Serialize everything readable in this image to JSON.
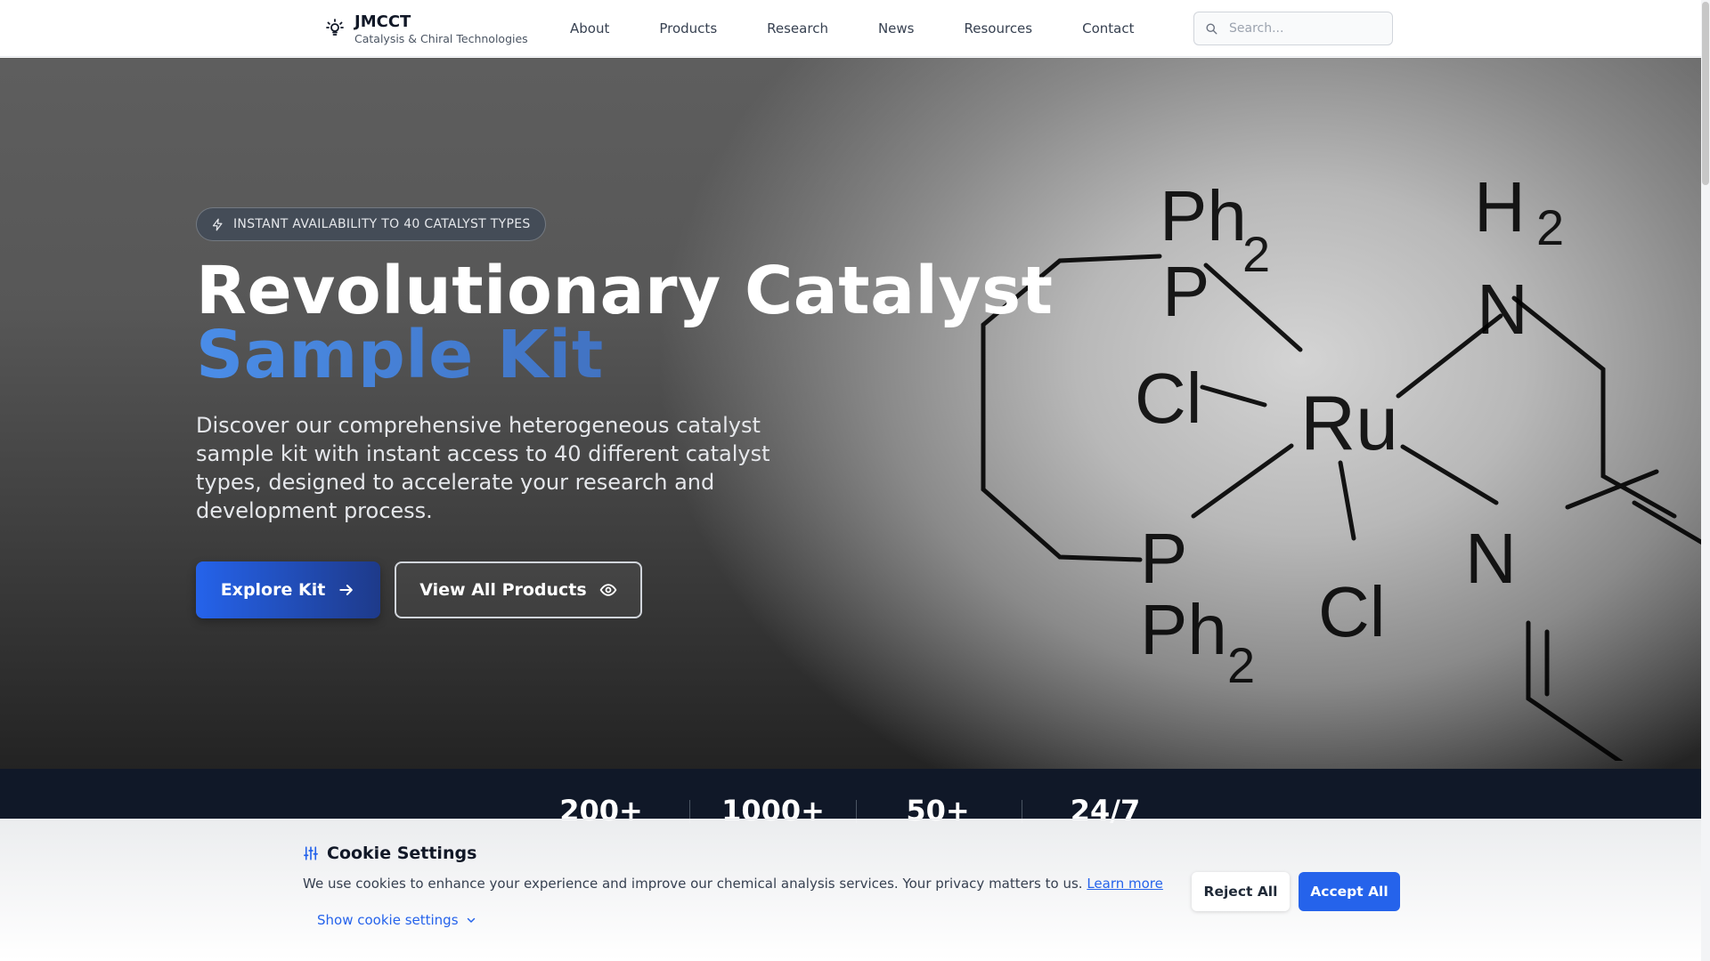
{
  "header": {
    "brand_name": "JMCCT",
    "brand_sub": "Catalysis & Chiral Technologies",
    "nav": [
      "About",
      "Products",
      "Research",
      "News",
      "Resources",
      "Contact"
    ],
    "search_placeholder": "Search..."
  },
  "hero": {
    "badge": "INSTANT AVAILABILITY TO 40 CATALYST TYPES",
    "title_line1": "Revolutionary Catalyst",
    "title_line2": "Sample Kit",
    "description": "Discover our comprehensive heterogeneous catalyst sample kit with instant access to 40 different catalyst types, designed to accelerate your research and development process.",
    "primary_button": "Explore Kit",
    "secondary_button": "View All Products",
    "molecule_labels": {
      "ph2_top": "Ph",
      "sub2": "2",
      "p": "P",
      "cl": "Cl",
      "ru": "Ru",
      "h2_h": "H",
      "n": "N",
      "ph2_bottom": "Ph"
    }
  },
  "stats": [
    "200+",
    "1000+",
    "50+",
    "24/7"
  ],
  "cookie": {
    "title": "Cookie Settings",
    "text": "We use cookies to enhance your experience and improve our chemical analysis services. Your privacy matters to us.",
    "learn_more": "Learn more",
    "show_settings": "Show cookie settings",
    "reject": "Reject All",
    "accept": "Accept All"
  },
  "colors": {
    "accent": "#2563eb",
    "stats_bg": "#101828",
    "header_bg": "#ffffff"
  },
  "icons": {
    "brand": "lightbulb-icon",
    "search": "search-icon",
    "badge": "lightning-icon",
    "primary_button": "arrow-right-icon",
    "secondary_button": "eye-icon",
    "cookie_title": "sliders-icon",
    "show_settings": "chevron-down-icon"
  }
}
